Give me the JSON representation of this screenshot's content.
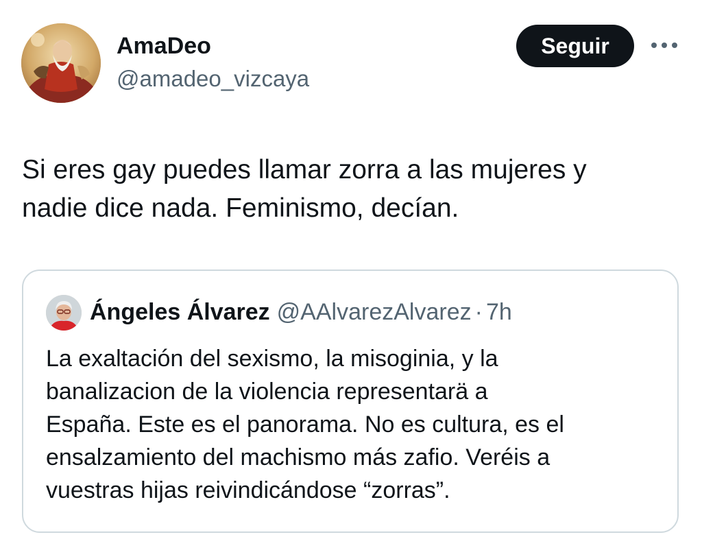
{
  "tweet": {
    "author": {
      "display_name": "AmaDeo",
      "handle": "@amadeo_vizcaya",
      "avatar": "profile-avatar-painting"
    },
    "follow_label": "Seguir",
    "more_icon": "more-horizontal-icon",
    "text": "Si eres gay puedes llamar zorra a las mujeres y\nnadie dice nada. Feminismo, decían."
  },
  "quote": {
    "author": {
      "display_name": "Ángeles Álvarez",
      "handle": "@AAlvarezAlvarez",
      "avatar": "profile-avatar-photo"
    },
    "separator": "·",
    "time": "7h",
    "text": "La exaltación del sexismo, la misoginia, y la\nbanalizacion de la violencia  representarä  a\nEspaña.  Este es el panorama. No es cultura, es el\nensalzamiento del machismo  más zafio.  Veréis a\nvuestras hijas reivindicándose “zorras”."
  },
  "colors": {
    "text_primary": "#0f1419",
    "text_secondary": "#536471",
    "border": "#cfd9de",
    "button_bg": "#0f1419",
    "button_text": "#ffffff"
  }
}
